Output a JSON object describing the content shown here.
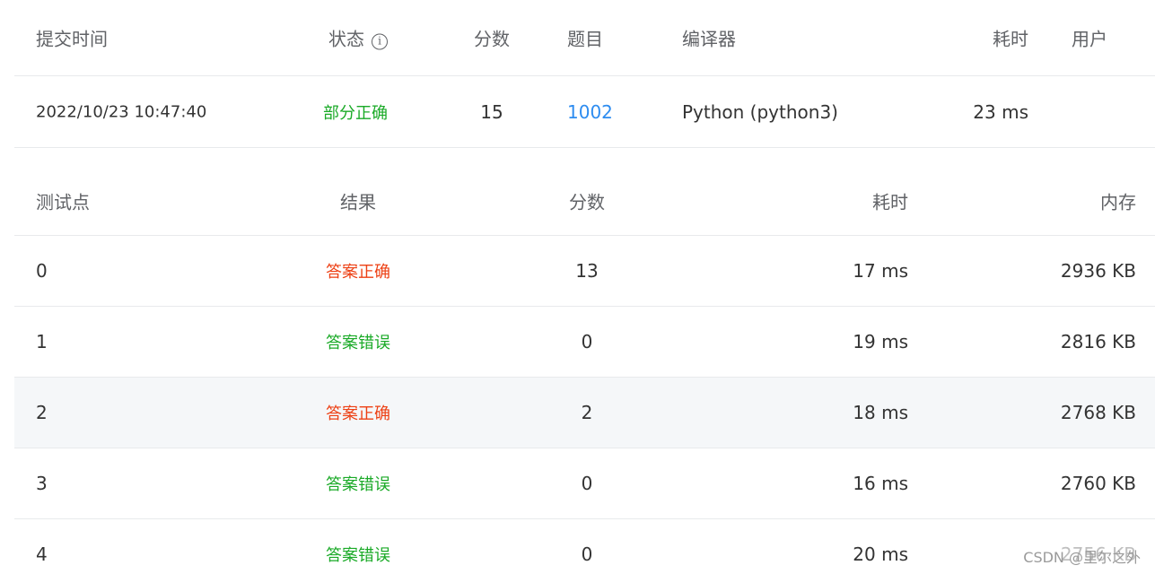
{
  "submission": {
    "headers": {
      "time": "提交时间",
      "status": "状态",
      "score": "分数",
      "problem": "题目",
      "compiler": "编译器",
      "elapsed": "耗时",
      "user": "用户"
    },
    "row": {
      "time": "2022/10/23 10:47:40",
      "status": "部分正确",
      "score": "15",
      "problem": "1002",
      "compiler": "Python (python3)",
      "elapsed": "23 ms",
      "user": ""
    }
  },
  "tests": {
    "headers": {
      "point": "测试点",
      "result": "结果",
      "score": "分数",
      "elapsed": "耗时",
      "memory": "内存"
    },
    "rows": [
      {
        "point": "0",
        "result": "答案正确",
        "score": "13",
        "elapsed": "17 ms",
        "memory": "2936 KB"
      },
      {
        "point": "1",
        "result": "答案错误",
        "score": "0",
        "elapsed": "19 ms",
        "memory": "2816 KB"
      },
      {
        "point": "2",
        "result": "答案正确",
        "score": "2",
        "elapsed": "18 ms",
        "memory": "2768 KB"
      },
      {
        "point": "3",
        "result": "答案错误",
        "score": "0",
        "elapsed": "16 ms",
        "memory": "2760 KB"
      },
      {
        "point": "4",
        "result": "答案错误",
        "score": "0",
        "elapsed": "20 ms",
        "memory": "2756 KB"
      }
    ]
  },
  "icons": {
    "status_info": "info-circle-icon"
  },
  "colors": {
    "correct": "#ed4014",
    "wrong": "#1aaa27",
    "partial": "#1aaa27",
    "link": "#2d8cf0",
    "highlight_row": "#f5f7f9"
  },
  "watermark": "CSDN @里尔之外"
}
